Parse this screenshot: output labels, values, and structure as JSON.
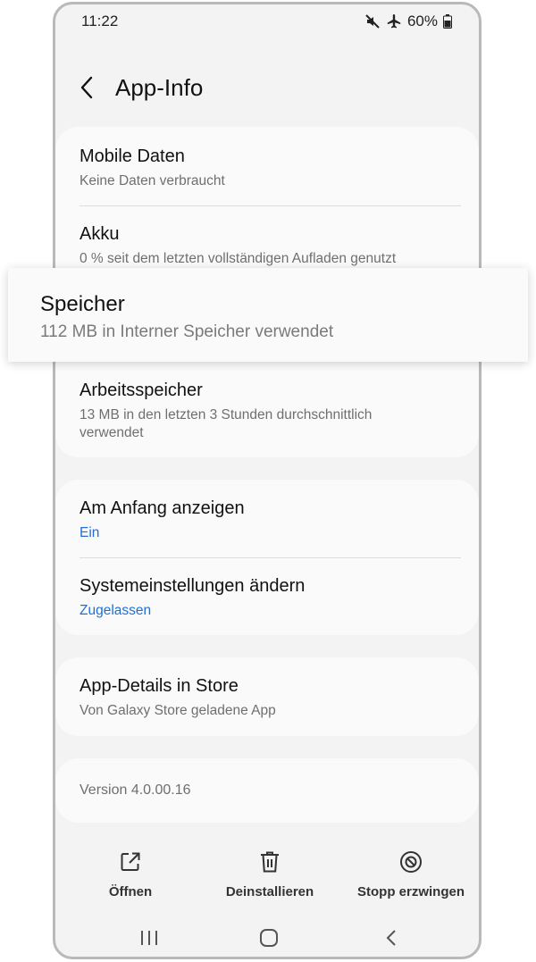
{
  "status_bar": {
    "time": "11:22",
    "battery": "60%"
  },
  "header": {
    "title": "App-Info"
  },
  "usage_card": {
    "mobile_data": {
      "title": "Mobile Daten",
      "subtitle": "Keine Daten verbraucht"
    },
    "battery": {
      "title": "Akku",
      "subtitle": "0 % seit dem letzten vollständigen Aufladen genutzt"
    },
    "storage": {
      "title": "Speicher",
      "subtitle": "112 MB in Interner Speicher verwendet"
    },
    "memory": {
      "title": "Arbeitsspeicher",
      "subtitle": "13 MB in den letzten 3 Stunden durchschnittlich verwendet"
    }
  },
  "advanced_card": {
    "appear_on_top": {
      "title": "Am Anfang anzeigen",
      "value": "Ein"
    },
    "modify_system": {
      "title": "Systemeinstellungen ändern",
      "value": "Zugelassen"
    }
  },
  "store_card": {
    "title": "App-Details in Store",
    "subtitle": "Von Galaxy Store geladene App"
  },
  "version_card": {
    "text": "Version 4.0.00.16"
  },
  "actions": {
    "open": "Öffnen",
    "uninstall": "Deinstallieren",
    "force_stop": "Stopp erzwingen"
  },
  "colors": {
    "accent": "#1f6fd6",
    "background": "#f3f3f3",
    "card": "#fafafa"
  },
  "icons": [
    "mute-icon",
    "airplane-icon",
    "battery-icon",
    "back-arrow-icon",
    "open-icon",
    "trash-icon",
    "force-stop-icon",
    "recents-icon",
    "home-icon",
    "nav-back-icon"
  ]
}
